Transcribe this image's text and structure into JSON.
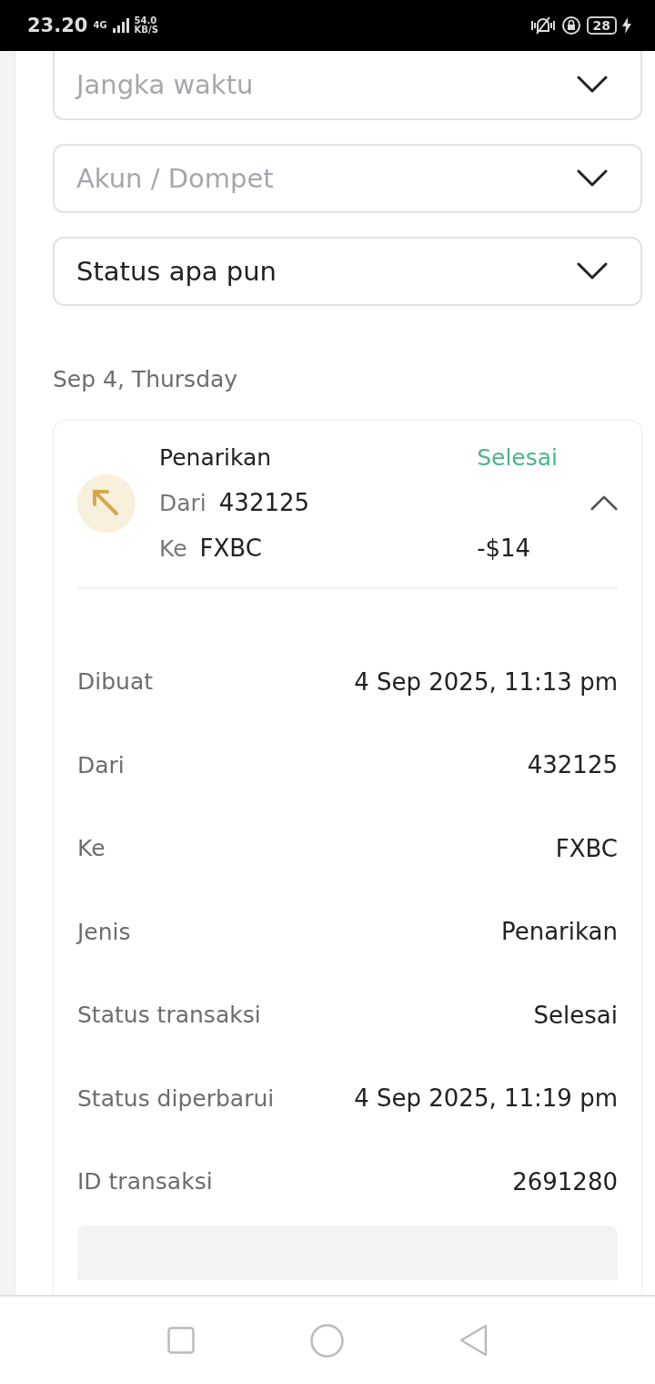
{
  "status_bar": {
    "time": "23.20",
    "network": "4G",
    "speed_value": "54.0",
    "speed_unit": "KB/S",
    "battery": "28"
  },
  "filters": [
    {
      "placeholder": "Jangka waktu"
    },
    {
      "placeholder": "Akun / Dompet"
    },
    {
      "value": "Status apa pun"
    }
  ],
  "date_heading": "Sep 4, Thursday",
  "transaction": {
    "type": "Penarikan",
    "status": "Selesai",
    "from_label": "Dari",
    "from": "432125",
    "to_label": "Ke",
    "to": "FXBC",
    "amount": "-$14",
    "expanded": true,
    "details": [
      {
        "label": "Dibuat",
        "value": "4 Sep 2025, 11:13 pm"
      },
      {
        "label": "Dari",
        "value": "432125"
      },
      {
        "label": "Ke",
        "value": "FXBC"
      },
      {
        "label": "Jenis",
        "value": "Penarikan"
      },
      {
        "label": "Status transaksi",
        "value": "Selesai"
      },
      {
        "label": "Status diperbarui",
        "value": "4 Sep 2025, 11:19 pm"
      },
      {
        "label": "ID transaksi",
        "value": "2691280"
      }
    ]
  }
}
